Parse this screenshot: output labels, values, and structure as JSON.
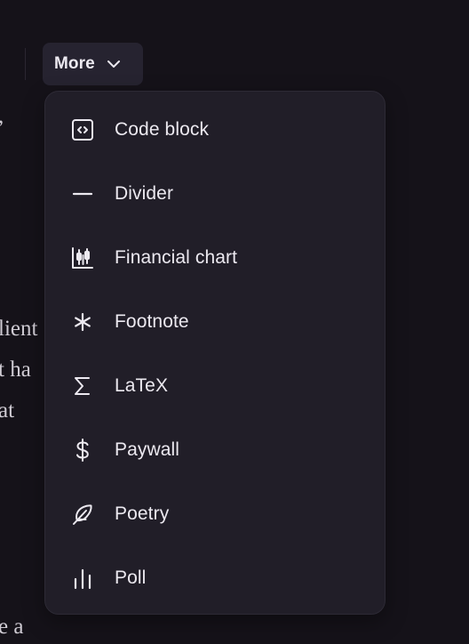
{
  "background_text": [
    {
      "id": "frag-1",
      "text": ","
    },
    {
      "id": "frag-2",
      "text": "lient"
    },
    {
      "id": "frag-3",
      "text": "t ha"
    },
    {
      "id": "frag-4",
      "text": "at"
    },
    {
      "id": "frag-5",
      "text": "e a"
    }
  ],
  "toolbar": {
    "more_label": "More",
    "more_icon": "chevron-down-icon"
  },
  "menu": {
    "items": [
      {
        "label": "Code block",
        "icon": "code-block-icon"
      },
      {
        "label": "Divider",
        "icon": "divider-icon"
      },
      {
        "label": "Financial chart",
        "icon": "financial-chart-icon"
      },
      {
        "label": "Footnote",
        "icon": "asterisk-icon"
      },
      {
        "label": "LaTeX",
        "icon": "sigma-icon"
      },
      {
        "label": "Paywall",
        "icon": "dollar-icon"
      },
      {
        "label": "Poetry",
        "icon": "feather-icon"
      },
      {
        "label": "Poll",
        "icon": "bar-chart-icon"
      }
    ]
  },
  "colors": {
    "background": "#151219",
    "menu_background": "#211e28",
    "button_background": "#262330",
    "text": "#ece9f0"
  }
}
